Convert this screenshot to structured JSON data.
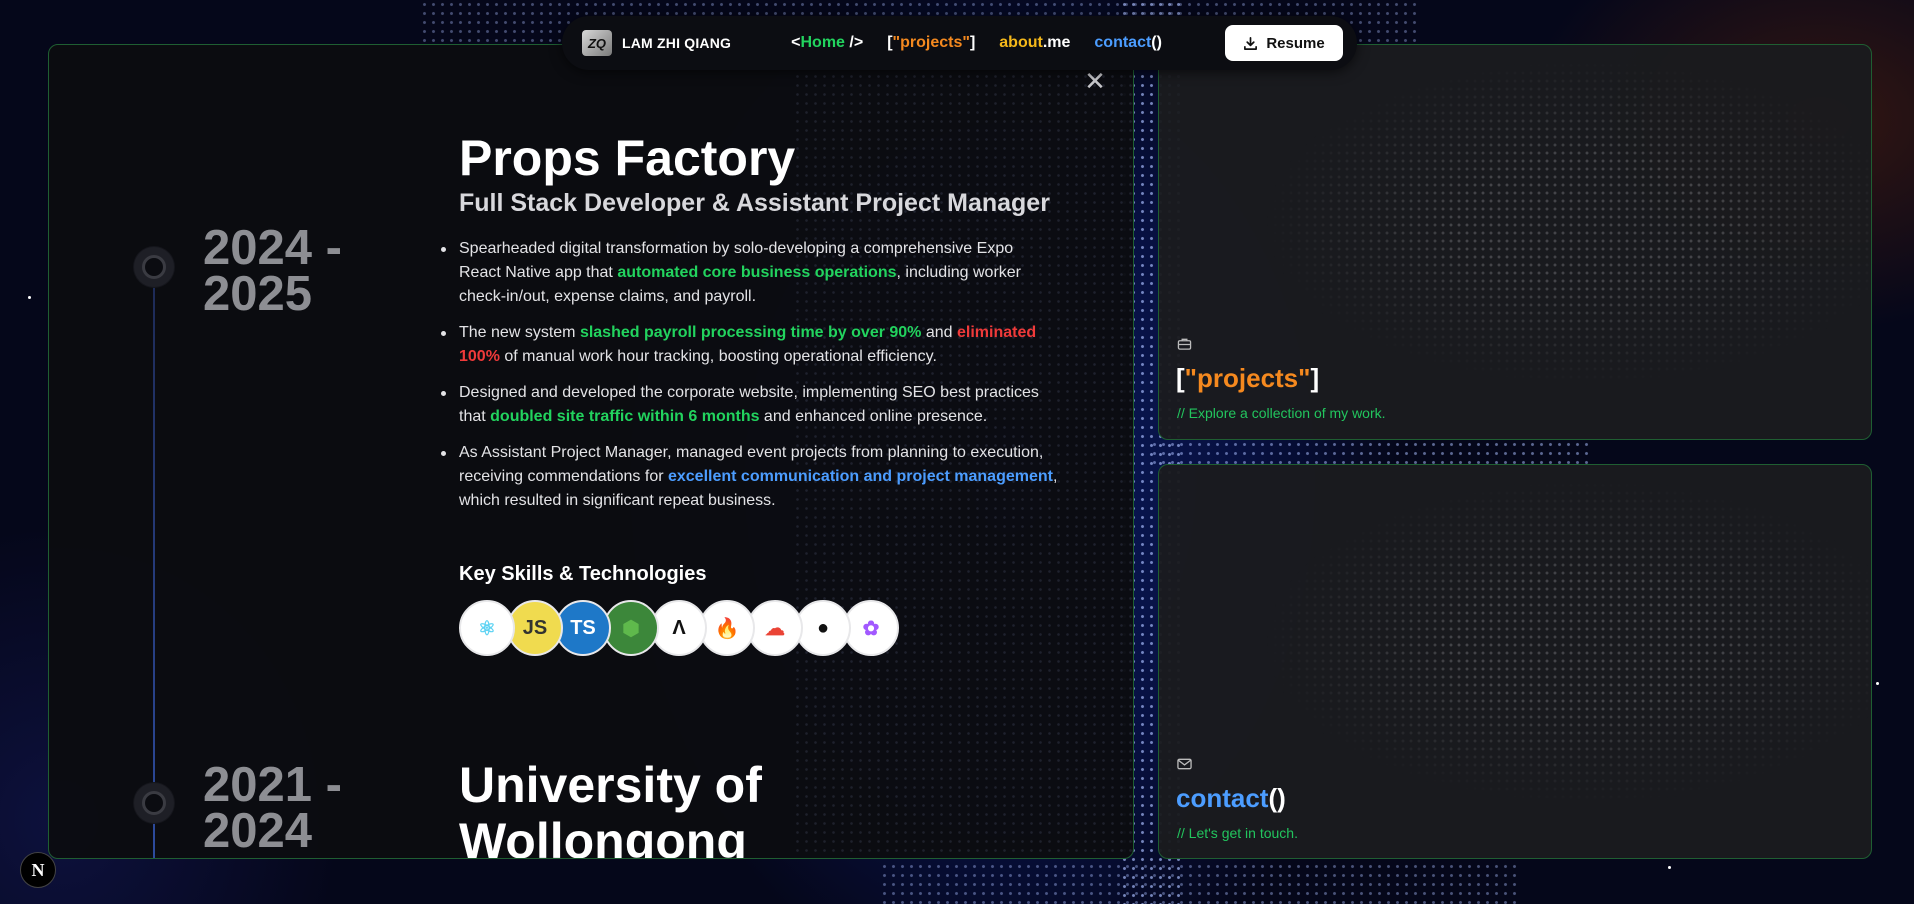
{
  "nav": {
    "brand_logo": "ZQ",
    "brand_name": "LAM ZHI QIANG",
    "home": {
      "open": "<",
      "text": "Home",
      "close": " />"
    },
    "projects": {
      "open": "[",
      "text": "\"projects\"",
      "close": "]"
    },
    "about": {
      "text": "about",
      "suffix": ".me"
    },
    "contact": {
      "text": "contact",
      "suffix": "()"
    },
    "resume_label": "Resume"
  },
  "experience": [
    {
      "years_line1": "2024 -",
      "years_line2": "2025",
      "company": "Props Factory",
      "role": "Full Stack Developer & Assistant Project Manager",
      "bullets": [
        {
          "a": "Spearheaded digital transformation by solo-developing a comprehensive Expo React Native app that ",
          "hl": "automated core business operations",
          "b": ", including worker check-in/out, expense claims, and payroll."
        },
        {
          "a": "The new system ",
          "hl": "slashed payroll processing time by over 90%",
          "b": " and ",
          "hl2": "eliminated 100%",
          "c": " of manual work hour tracking, boosting operational efficiency."
        },
        {
          "a": "Designed and developed the corporate website, implementing SEO best practices that ",
          "hl": "doubled site traffic within 6 months",
          "b": " and enhanced online presence."
        },
        {
          "a": "As Assistant Project Manager, managed event projects from planning to execution, receiving commendations for ",
          "hl": "excellent communication and project management",
          "b": ", which resulted in significant repeat business."
        }
      ],
      "skills_title": "Key Skills & Technologies",
      "skills": [
        {
          "name": "react-icon",
          "glyph": "⚛",
          "bg": "#ffffff",
          "fg": "#5ed3f3"
        },
        {
          "name": "javascript-icon",
          "glyph": "JS",
          "bg": "#f0db4f",
          "fg": "#323330"
        },
        {
          "name": "typescript-icon",
          "glyph": "TS",
          "bg": "#1e78c8",
          "fg": "#ffffff"
        },
        {
          "name": "nodejs-icon",
          "glyph": "⬢",
          "bg": "#3c873a",
          "fg": "#5fb94c"
        },
        {
          "name": "expo-icon",
          "glyph": "Λ",
          "bg": "#ffffff",
          "fg": "#111111"
        },
        {
          "name": "firebase-icon",
          "glyph": "🔥",
          "bg": "#ffffff",
          "fg": "#f5a623"
        },
        {
          "name": "google-cloud-icon",
          "glyph": "☁",
          "bg": "#ffffff",
          "fg": "#ea4335"
        },
        {
          "name": "github-icon",
          "glyph": "●",
          "bg": "#ffffff",
          "fg": "#111111"
        },
        {
          "name": "figma-icon",
          "glyph": "✿",
          "bg": "#ffffff",
          "fg": "#a259ff"
        }
      ]
    },
    {
      "years_line1": "2021 -",
      "years_line2": "2024",
      "company_line1": "University of",
      "company_line2": "Wollongong"
    }
  ],
  "cards": {
    "projects": {
      "open": "[",
      "text": "\"projects\"",
      "close": "]",
      "sub": "// Explore a collection of my work."
    },
    "contact": {
      "text": "contact",
      "suffix": "()",
      "sub": "// Let's get in touch."
    }
  },
  "next_badge": "N",
  "colors": {
    "green": "#22d35e",
    "orange": "#f5891f",
    "yellow": "#f5b81a",
    "blue": "#4c9dff",
    "red": "#ef3a3a"
  }
}
